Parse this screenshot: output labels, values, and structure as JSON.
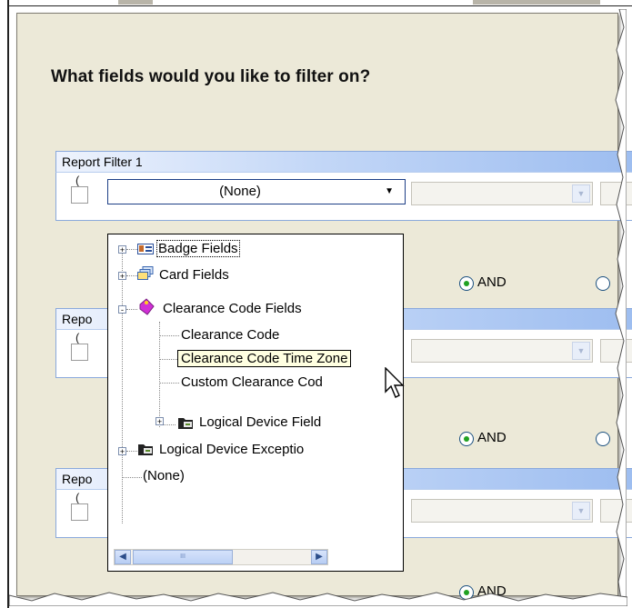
{
  "prompt": "What fields would you like to filter on?",
  "filter_groups": [
    {
      "title": "Report Filter 1",
      "combo_value": "(None)",
      "and_label": "AND",
      "and_selected": true
    },
    {
      "title": "Repo",
      "combo_value": "",
      "and_label": "AND",
      "and_selected": true
    },
    {
      "title": "Repo",
      "combo_value": "",
      "and_label": "AND",
      "and_selected": true
    }
  ],
  "dropdown": {
    "items": [
      {
        "label": "Badge Fields",
        "icon": "badge-icon",
        "expander": "+"
      },
      {
        "label": "Card Fields",
        "icon": "cards-icon",
        "expander": "+"
      },
      {
        "label": "Clearance Code Fields",
        "icon": "tag-icon",
        "expander": "-"
      },
      {
        "label": "Clearance Code",
        "icon": "",
        "expander": ""
      },
      {
        "label": "Clearance Code Time Zone",
        "icon": "",
        "expander": ""
      },
      {
        "label": "Custom Clearance Cod",
        "icon": "",
        "expander": ""
      },
      {
        "label": "Logical Device Field",
        "icon": "device-icon",
        "expander": "+"
      },
      {
        "label": "Logical Device Exceptio",
        "icon": "device-icon",
        "expander": "+"
      },
      {
        "label": "(None)",
        "icon": "",
        "expander": ""
      }
    ],
    "scroll_thumb_text": "III"
  },
  "colors": {
    "group_header_light": "#eef3fd",
    "group_header_dark": "#9dbdf0",
    "tooltip_bg": "#ffffe1",
    "radio_dot": "#21a121"
  }
}
